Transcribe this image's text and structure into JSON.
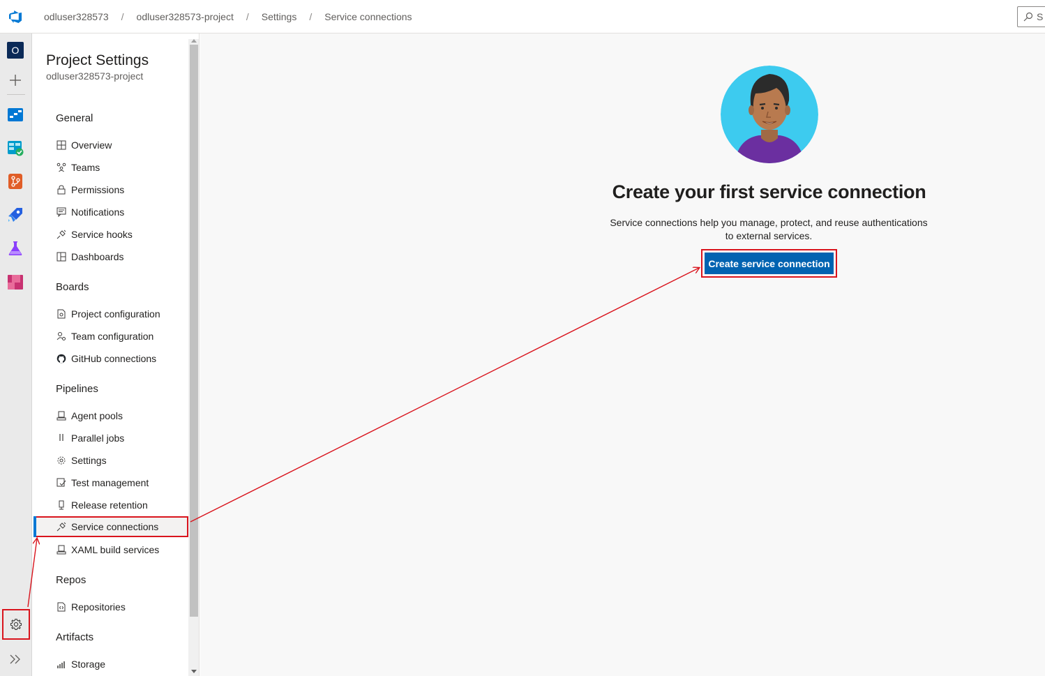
{
  "breadcrumb": [
    "odluser328573",
    "odluser328573-project",
    "Settings",
    "Service connections"
  ],
  "search": {
    "label": "S"
  },
  "rail": {
    "org_initial": "O",
    "icons": [
      "azure-devops-logo-icon",
      "plus-icon",
      "boards-icon",
      "test-plans-check-icon",
      "repos-icon",
      "pipelines-icon",
      "test-flask-icon",
      "artifacts-icon",
      "gear-icon",
      "expand-chevrons-icon"
    ]
  },
  "settings_nav": {
    "title": "Project Settings",
    "subtitle": "odluser328573-project",
    "groups": [
      {
        "heading": "General",
        "items": [
          "Overview",
          "Teams",
          "Permissions",
          "Notifications",
          "Service hooks",
          "Dashboards"
        ]
      },
      {
        "heading": "Boards",
        "items": [
          "Project configuration",
          "Team configuration",
          "GitHub connections"
        ]
      },
      {
        "heading": "Pipelines",
        "items": [
          "Agent pools",
          "Parallel jobs",
          "Settings",
          "Test management",
          "Release retention",
          "Service connections",
          "XAML build services"
        ]
      },
      {
        "heading": "Repos",
        "items": [
          "Repositories"
        ]
      },
      {
        "heading": "Artifacts",
        "items": [
          "Storage"
        ]
      }
    ],
    "selected": "Service connections"
  },
  "main": {
    "title": "Create your first service connection",
    "description": "Service connections help you manage, protect, and reuse authentications to external services.",
    "button_label": "Create service connection"
  },
  "colors": {
    "accent": "#0078d4",
    "button": "#0063b1",
    "annotation": "#d9141d",
    "avatar_bg": "#3dcbef"
  }
}
